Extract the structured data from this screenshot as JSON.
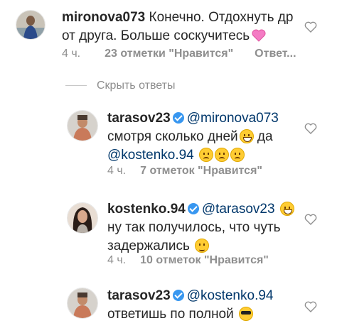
{
  "colors": {
    "mention": "#00376b",
    "meta": "#8e8e8e",
    "verified": "#3897f0"
  },
  "comments": [
    {
      "username": "mironova073",
      "line1": "Конечно. Отдохнуть др",
      "line2": "от друга. Больше соскучитесь",
      "emoji": "sparkling-heart",
      "time": "4 ч.",
      "likes": "23 отметки \"Нравится\"",
      "reply": "Ответ..."
    },
    {
      "username": "tarasov23",
      "verified": true,
      "mention": "@mironova073",
      "line2": "смотря сколько дней",
      "line2_tail": "да",
      "mention2": "@kostenko.94",
      "time": "4 ч.",
      "likes": "7 отметок \"Нравится\""
    },
    {
      "username": "kostenko.94",
      "verified": true,
      "mention": "@tarasov23",
      "line2": "ну так получилось, что чуть",
      "line3": "задержались",
      "time": "4 ч.",
      "likes": "10 отметок \"Нравится\""
    },
    {
      "username": "tarasov23",
      "verified": true,
      "mention": "@kostenko.94",
      "line2": "ответишь по полной"
    }
  ],
  "hide_replies": "Скрыть ответы"
}
